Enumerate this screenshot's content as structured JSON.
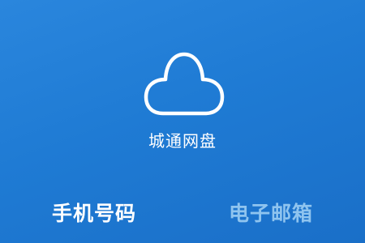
{
  "app": {
    "name": "城通网盘",
    "logo_icon": "cloud-icon"
  },
  "login_tabs": [
    {
      "label": "手机号码",
      "selected": true
    },
    {
      "label": "电子邮箱",
      "selected": false
    }
  ],
  "colors": {
    "background": "#1f7bd4",
    "active_tab": "#ffffff",
    "inactive_tab": "#8fc4ef"
  }
}
